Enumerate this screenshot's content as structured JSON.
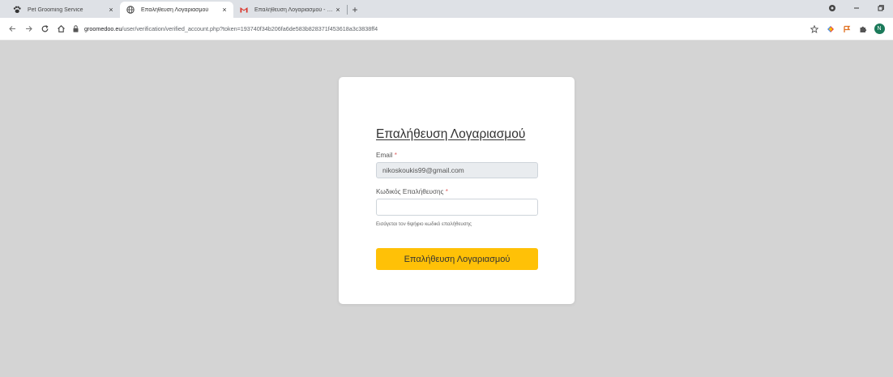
{
  "browser": {
    "tabs": [
      {
        "title": "Pet Grooming Service",
        "icon": "paw-icon",
        "active": false
      },
      {
        "title": "Επαλήθευση Λογαριασμού",
        "icon": "globe-icon",
        "active": true
      },
      {
        "title": "Επαλήθευση Λογαριασμού - nik",
        "icon": "gmail-icon",
        "active": false
      }
    ],
    "close_glyph": "×",
    "new_tab_glyph": "+",
    "url": {
      "host": "groomedoo.eu",
      "path": "/user/verification/verified_account.php?token=193740f34b206fa6de583b828371f453618a3c3838ff4"
    },
    "avatar_letter": "N"
  },
  "form": {
    "title": "Επαλήθευση Λογαριασμού",
    "email_label": "Email",
    "required_mark": "*",
    "email_value": "nikoskoukis99@gmail.com",
    "code_label": "Κωδικός Επαλήθευσης",
    "code_value": "",
    "help_text": "Εισάγεται τον 6ψήφιο κωδικό επαλήθευσης",
    "submit_label": "Επαλήθευση Λογαριασμού"
  },
  "colors": {
    "page_background": "#d4d4d4",
    "button": "#ffc107",
    "required": "#e06666"
  }
}
